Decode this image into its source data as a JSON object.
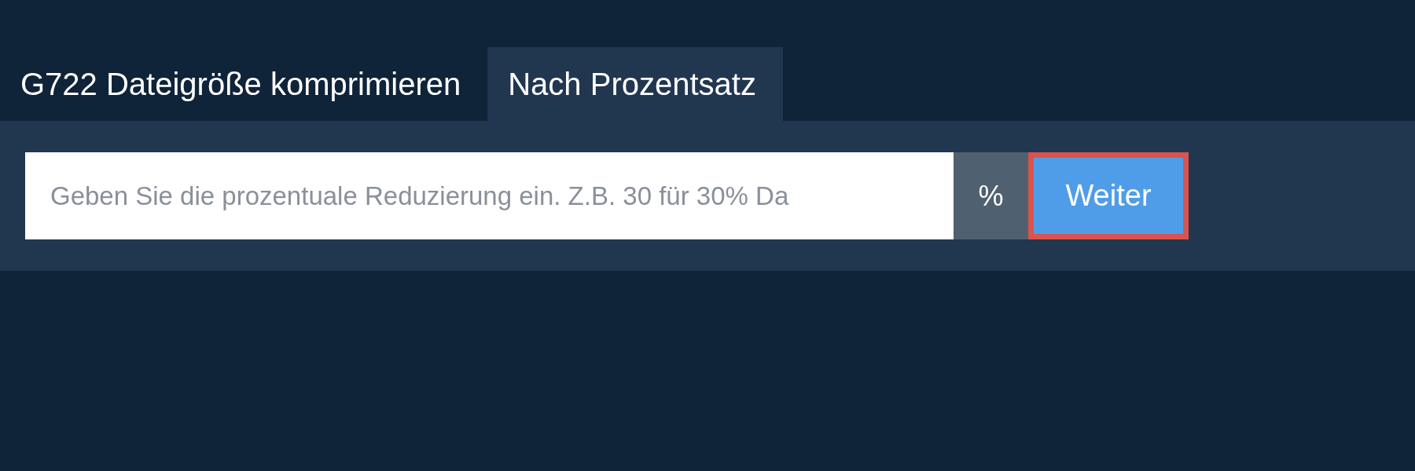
{
  "tabs": [
    {
      "label": "G722 Dateigröße komprimieren",
      "selected": false
    },
    {
      "label": "Nach Prozentsatz",
      "selected": true
    }
  ],
  "form": {
    "input": {
      "placeholder": "Geben Sie die prozentuale Reduzierung ein. Z.B. 30 für 30% Da"
    },
    "unit": "%",
    "button": {
      "label": "Weiter",
      "focused": true
    }
  }
}
